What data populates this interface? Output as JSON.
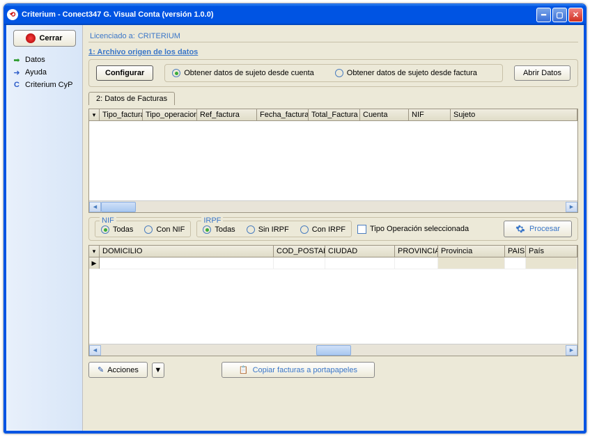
{
  "window": {
    "title": "Criterium - Conect347 G. Visual Conta (versión 1.0.0)"
  },
  "sidebar": {
    "cerrar": "Cerrar",
    "items": [
      {
        "label": "Datos"
      },
      {
        "label": "Ayuda"
      },
      {
        "label": "Criterium CyP"
      }
    ]
  },
  "license": {
    "prefix": "Licenciado a:",
    "name": "CRITERIUM"
  },
  "section1": {
    "title": "1: Archivo origen de los datos",
    "configurar": "Configurar",
    "radio_cuenta": "Obtener datos de sujeto desde cuenta",
    "radio_factura": "Obtener datos de sujeto desde factura",
    "abrir": "Abrir Datos"
  },
  "tab2": {
    "label": "2: Datos de Facturas"
  },
  "grid1": {
    "cols": [
      "Tipo_factura",
      "Tipo_operacion",
      "Ref_factura",
      "Fecha_factura",
      "Total_Factura",
      "Cuenta",
      "NIF",
      "Sujeto"
    ]
  },
  "filters": {
    "nif": {
      "legend": "NIF",
      "todas": "Todas",
      "con": "Con NIF"
    },
    "irpf": {
      "legend": "IRPF",
      "todas": "Todas",
      "sin": "Sin IRPF",
      "con": "Con IRPF"
    },
    "tipo_op": "Tipo Operación seleccionada",
    "procesar": "Procesar"
  },
  "grid2": {
    "cols": [
      "DOMICILIO",
      "COD_POSTAL",
      "CIUDAD",
      "PROVINCIA",
      "Provincia",
      "PAIS",
      "País"
    ]
  },
  "bottom": {
    "acciones": "Acciones",
    "copiar": "Copiar facturas a portapapeles"
  }
}
